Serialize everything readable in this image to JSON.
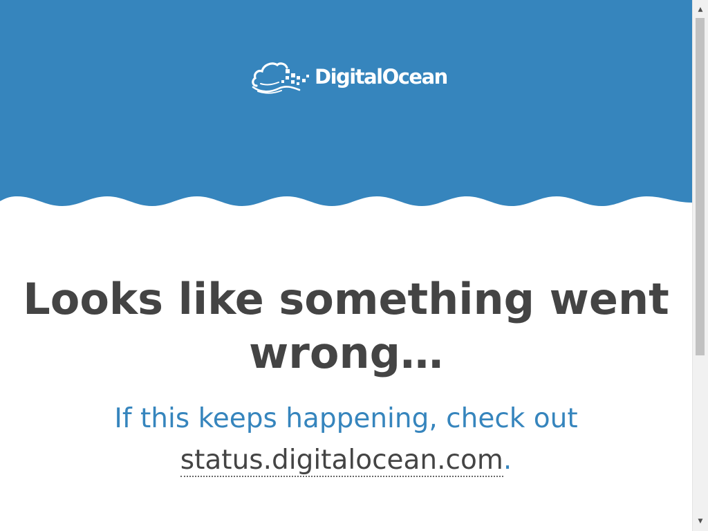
{
  "header": {
    "background_color": "#3685bd",
    "logo_text": "DigitalOcean",
    "logo_icon": "digitalocean-cloud-icon"
  },
  "main": {
    "headline": "Looks like something went wrong…",
    "subtext_prefix": "If this keeps happening, check out",
    "status_link_text": "status.digitalocean.com",
    "subtext_suffix": ".",
    "headline_color": "#444444",
    "subtext_color": "#3685bd"
  },
  "scrollbar": {
    "up_arrow_icon": "scroll-up-arrow-icon",
    "down_arrow_icon": "scroll-down-arrow-icon"
  }
}
